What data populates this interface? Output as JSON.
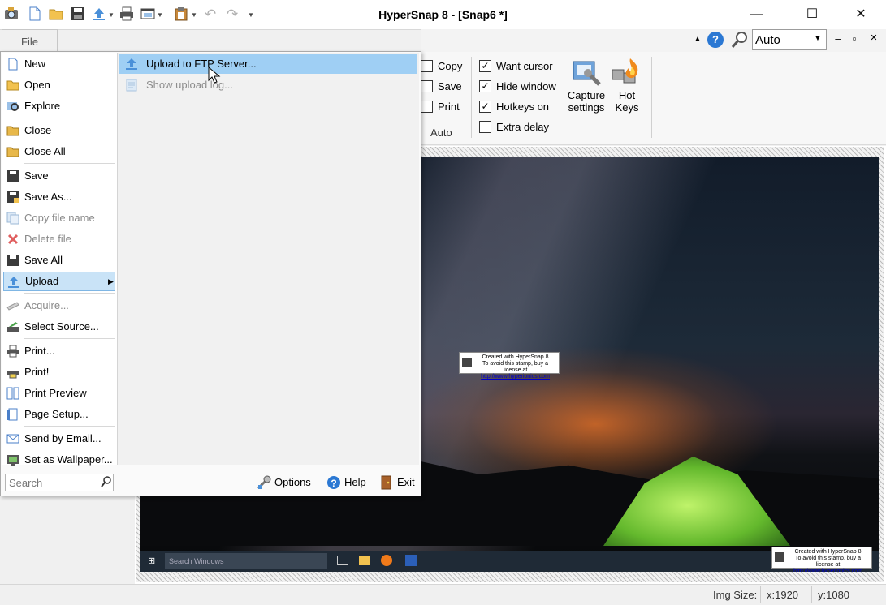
{
  "app": {
    "title": "HyperSnap 8 - [Snap6 *]",
    "accent": "#2b78d3"
  },
  "quick_access": {
    "icons": [
      "app-camera-icon",
      "new-icon",
      "open-icon",
      "save-icon",
      "upload-icon",
      "print-icon",
      "window-icon",
      "clipboard-icon",
      "undo-icon",
      "redo-icon",
      "customize-icon"
    ]
  },
  "window_controls": {
    "minimize": "—",
    "maximize": "☐",
    "close": "✕"
  },
  "ribbon": {
    "zoom_value": "Auto",
    "help_glyph": "?",
    "minimize_ribbon": "–",
    "restore_ribbon": "▫",
    "close_doc": "✕",
    "auto_group": {
      "checks": [
        {
          "label": "Copy",
          "checked": false
        },
        {
          "label": "Save",
          "checked": false
        },
        {
          "label": "Print",
          "checked": false
        }
      ],
      "group_label": "Auto"
    },
    "options_group": {
      "checks": [
        {
          "label": "Want cursor",
          "checked": true
        },
        {
          "label": "Hide window",
          "checked": true
        },
        {
          "label": "Hotkeys on",
          "checked": true
        },
        {
          "label": "Extra delay",
          "checked": false
        }
      ]
    },
    "big_buttons": [
      {
        "line1": "Capture",
        "line2": "settings"
      },
      {
        "line1": "Hot",
        "line2": "Keys"
      }
    ]
  },
  "file_menu": {
    "tab_label": "File",
    "items": [
      {
        "label": "New",
        "icon": "new-file-icon",
        "enabled": true
      },
      {
        "label": "Open",
        "icon": "folder-open-icon",
        "enabled": true
      },
      {
        "label": "Explore",
        "icon": "explore-icon",
        "enabled": true
      },
      {
        "label": "Close",
        "icon": "folder-close-icon",
        "enabled": true
      },
      {
        "label": "Close All",
        "icon": "folder-close-all-icon",
        "enabled": true
      },
      {
        "label": "Save",
        "icon": "floppy-icon",
        "enabled": true
      },
      {
        "label": "Save As...",
        "icon": "floppy-as-icon",
        "enabled": true
      },
      {
        "label": "Copy file name",
        "icon": "copy-icon",
        "enabled": false
      },
      {
        "label": "Delete file",
        "icon": "delete-icon",
        "enabled": false
      },
      {
        "label": "Save All",
        "icon": "floppy-all-icon",
        "enabled": true
      },
      {
        "label": "Upload",
        "icon": "upload-icon",
        "enabled": true,
        "selected": true
      },
      {
        "label": "Acquire...",
        "icon": "scanner-icon",
        "enabled": false
      },
      {
        "label": "Select Source...",
        "icon": "source-icon",
        "enabled": true
      },
      {
        "label": "Print...",
        "icon": "printer-icon",
        "enabled": true
      },
      {
        "label": "Print!",
        "icon": "print-now-icon",
        "enabled": true
      },
      {
        "label": "Print Preview",
        "icon": "preview-icon",
        "enabled": true
      },
      {
        "label": "Page Setup...",
        "icon": "page-setup-icon",
        "enabled": true
      },
      {
        "label": "Send by Email...",
        "icon": "email-icon",
        "enabled": true
      },
      {
        "label": "Set as Wallpaper...",
        "icon": "wallpaper-icon",
        "enabled": true
      }
    ],
    "submenu": [
      {
        "label": "Upload to FTP Server...",
        "enabled": true,
        "selected": true
      },
      {
        "label": "Show upload log...",
        "enabled": false
      }
    ],
    "search_placeholder": "Search",
    "bottom_buttons": [
      "Options",
      "Help",
      "Exit"
    ]
  },
  "canvas": {
    "taskbar_search": "Search Windows",
    "stamp": {
      "line1": "Created with HyperSnap 8",
      "line2": "To avoid this stamp, buy a license at",
      "link": "http://www.hyperionics.com"
    }
  },
  "status": {
    "img_size_label": "Img Size:",
    "x": "x:1920",
    "y": "y:1080"
  }
}
